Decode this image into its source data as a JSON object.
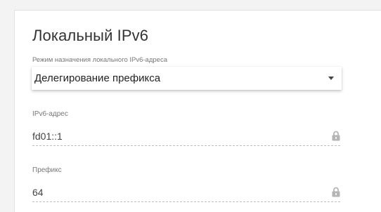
{
  "section": {
    "title": "Локальный IPv6"
  },
  "mode_select": {
    "label": "Режим назначения локального IPv6-адреса",
    "value": "Делегирование префикса"
  },
  "ipv6_field": {
    "label": "IPv6-адрес",
    "value": "fd01::1",
    "icon": "lock-icon"
  },
  "prefix_field": {
    "label": "Префикс",
    "value": "64",
    "icon": "lock-icon"
  },
  "colors": {
    "background": "#f3f3f3",
    "card": "#ffffff",
    "title": "#333333",
    "muted_text": "#777777",
    "icon": "#b5b5b5"
  }
}
